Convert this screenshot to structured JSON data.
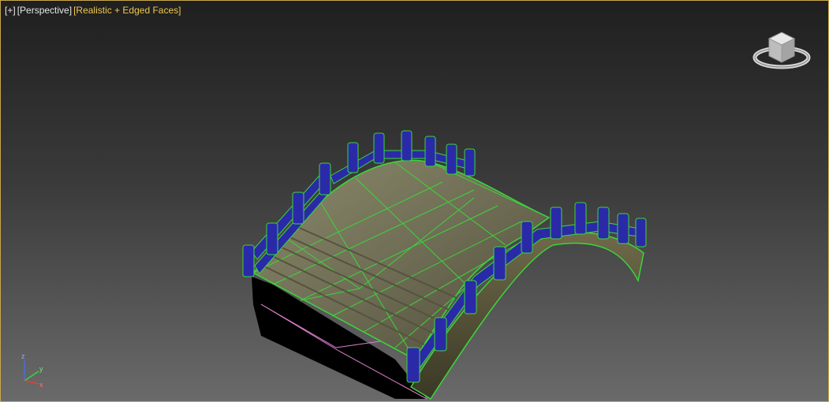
{
  "viewport": {
    "menu_label": "[+]",
    "view_label": "[Perspective]",
    "shading_label": "[Realistic + Edged Faces]",
    "colors": {
      "border": "#c8a84a",
      "shading_text": "#f0c850",
      "wire_green": "#3bd63b",
      "rail_blue": "#2a2aa8",
      "deck": "#7b7a5c",
      "selection_pink": "#e080d0"
    }
  },
  "axis": {
    "x": "x",
    "y": "y",
    "z": "z"
  },
  "icons": {
    "viewcube": "viewcube-icon",
    "axis": "axis-tripod-icon"
  }
}
